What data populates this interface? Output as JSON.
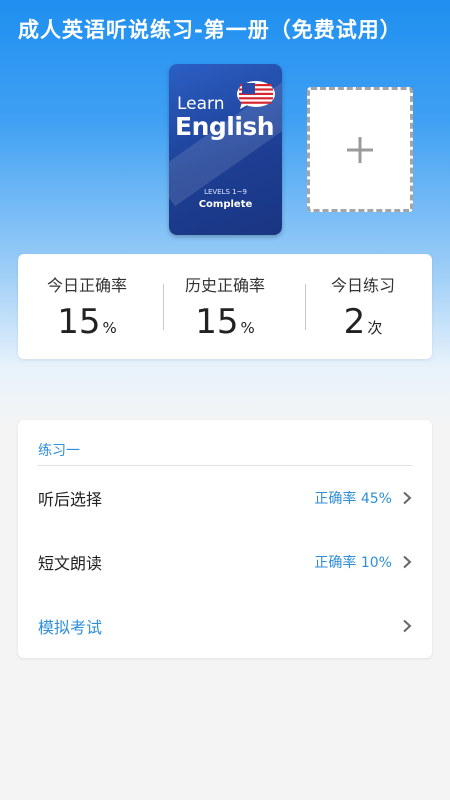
{
  "app": {
    "title": "成人英语听说练习-第一册（免费试用）"
  },
  "book": {
    "learn_text": "Learn",
    "english_text": "English",
    "levels_text": "LEVELS 1~9",
    "complete_text": "Complete"
  },
  "add_book": {
    "icon": "plus-icon"
  },
  "stats": [
    {
      "label": "今日正确率",
      "value": "15",
      "unit": "%"
    },
    {
      "label": "历史正确率",
      "value": "15",
      "unit": "%"
    },
    {
      "label": "今日练习",
      "value": "2",
      "unit": "次"
    }
  ],
  "practice": {
    "section_title": "练习一",
    "items": [
      {
        "label": "听后选择",
        "rate": "正确率 45%"
      },
      {
        "label": "短文朗读",
        "rate": "正确率 10%"
      },
      {
        "label": "模拟考试",
        "rate": ""
      }
    ]
  },
  "colors": {
    "header_blue": "#1f8ff0",
    "accent_blue": "#2f8fd8"
  }
}
